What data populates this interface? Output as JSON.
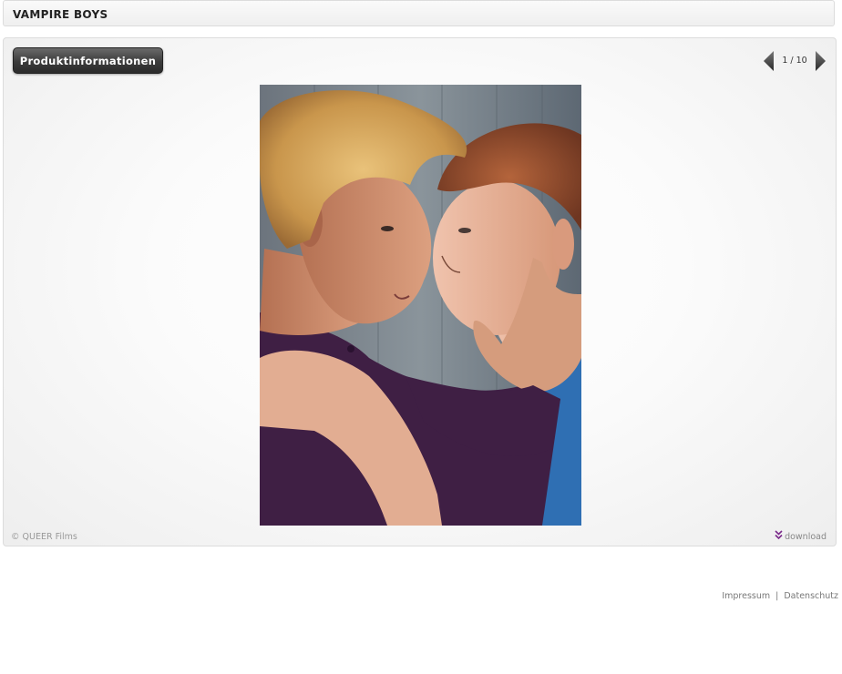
{
  "header": {
    "title": "VAMPIRE BOYS"
  },
  "gallery": {
    "info_button_label": "Produktinformationen",
    "pager": {
      "current": 1,
      "total": 10,
      "text": "1 / 10"
    },
    "photo_alt": "Production still",
    "copyright_symbol": "©",
    "copyright": "QUEER Films",
    "download_label": "download",
    "download_icon": "double-chevron-down-icon"
  },
  "footer": {
    "impressum": "Impressum",
    "separator": "|",
    "datenschutz": "Datenschutz"
  },
  "colors": {
    "button_dark": "#3b3b3b",
    "download_icon": "#7a2a8a",
    "shirt_purple": "#3f1f44",
    "shirt_blue": "#2f6fb3"
  }
}
